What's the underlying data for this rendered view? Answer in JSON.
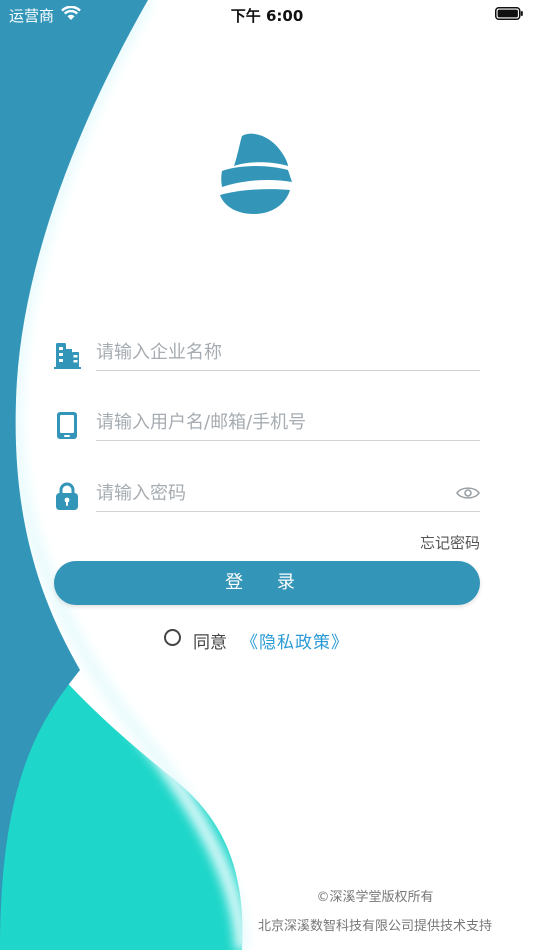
{
  "status_bar": {
    "carrier": "运营商",
    "time": "下午 6:00"
  },
  "form": {
    "company_placeholder": "请输入企业名称",
    "username_placeholder": "请输入用户名/邮箱/手机号",
    "password_placeholder": "请输入密码",
    "forgot_password": "忘记密码",
    "login_button": "登 录"
  },
  "agreement": {
    "agree_label": "同意",
    "privacy_link": "《隐私政策》"
  },
  "footer": {
    "copyright": "©深溪学堂版权所有",
    "support": "北京深溪数智科技有限公司提供技术支持"
  },
  "icons": {
    "company": "building-icon",
    "username": "phone-icon",
    "password": "lock-icon",
    "show_password": "eye-icon",
    "logo": "water-drop-logo"
  },
  "colors": {
    "primary": "#3395b8",
    "accent_teal": "#1ed6c9",
    "link": "#2a9ad6"
  }
}
